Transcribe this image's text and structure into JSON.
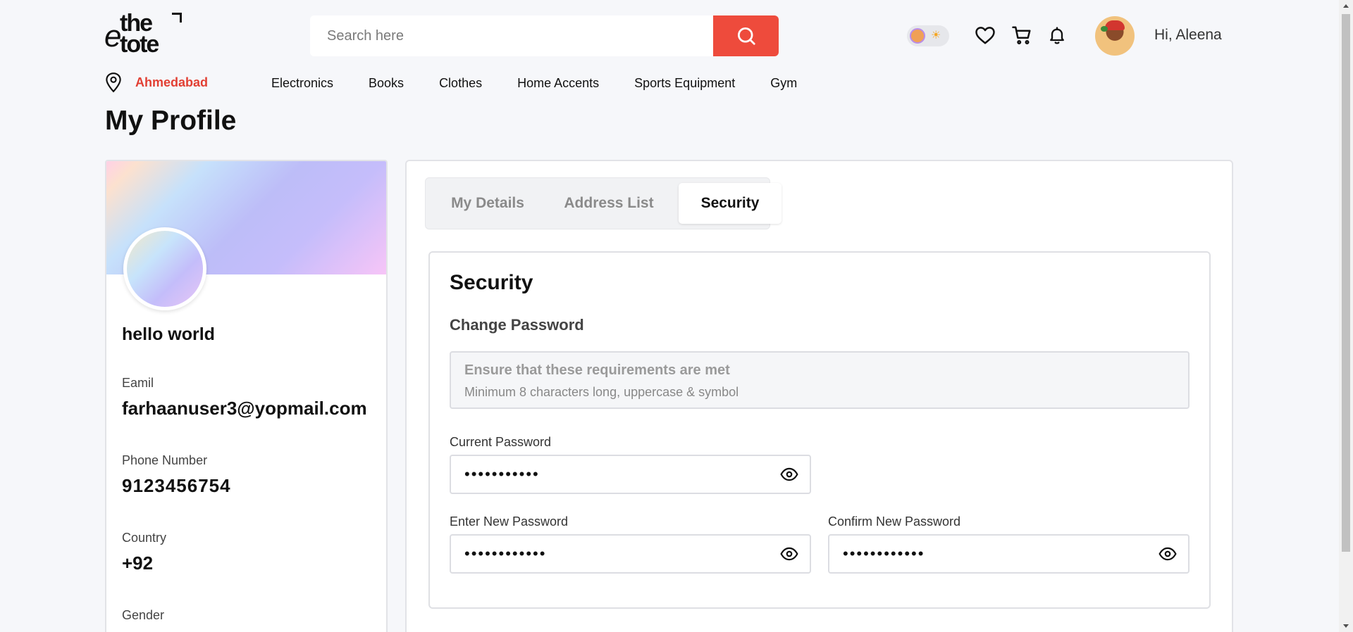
{
  "brand": {
    "logo_line1": "the",
    "logo_line2": "tote",
    "logo_mark": "e"
  },
  "header": {
    "search_placeholder": "Search here",
    "greeting": "Hi, Aleena",
    "icons": [
      "search-icon",
      "heart-icon",
      "cart-icon",
      "bell-icon",
      "sun-icon"
    ],
    "theme_toggle": "light"
  },
  "location": {
    "name": "Ahmedabad",
    "icon": "map-pin-icon"
  },
  "nav": [
    "Electronics",
    "Books",
    "Clothes",
    "Home Accents",
    "Sports Equipment",
    "Gym"
  ],
  "page_title": "My Profile",
  "profile": {
    "name": "hello world",
    "email_label": "Eamil",
    "email": "farhaanuser3@yopmail.com",
    "phone_label": "Phone Number",
    "phone": "9123456754",
    "country_label": "Country",
    "country": "+92",
    "gender_label": "Gender"
  },
  "tabs": [
    {
      "label": "My Details",
      "active": false
    },
    {
      "label": "Address List",
      "active": false
    },
    {
      "label": "Security",
      "active": true
    }
  ],
  "security": {
    "title": "Security",
    "subtitle": "Change Password",
    "requirements_title": "Ensure that these requirements are met",
    "requirements_text": "Minimum 8 characters long, uppercase & symbol",
    "current_label": "Current Password",
    "current_value": "•••••••••••",
    "new_label": "Enter New Password",
    "new_value": "••••••••••••",
    "confirm_label": "Confirm New Password",
    "confirm_value": "••••••••••••"
  },
  "colors": {
    "accent": "#ee4b3c",
    "location": "#e23f33",
    "page_bg": "#f6f7fa"
  }
}
